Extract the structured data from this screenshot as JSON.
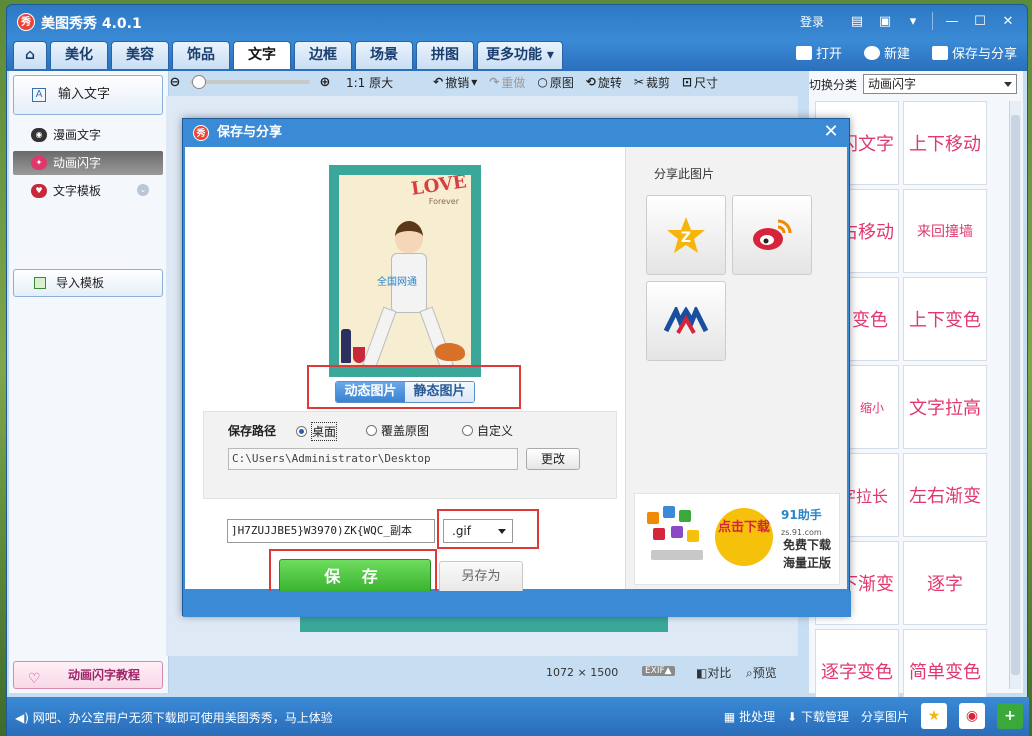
{
  "app": {
    "title": "美图秀秀 4.0.1",
    "logo_text": "秀",
    "login": "登录"
  },
  "tabs": [
    "美化",
    "美容",
    "饰品",
    "文字",
    "边框",
    "场景",
    "拼图",
    "更多功能"
  ],
  "active_tab": "文字",
  "quick_actions": {
    "open": "打开",
    "new": "新建",
    "save_share": "保存与分享"
  },
  "left_panel": {
    "input_text": "输入文字",
    "items": [
      "漫画文字",
      "动画闪字",
      "文字模板"
    ],
    "selected": "动画闪字",
    "import": "导入模板",
    "tutorial": "动画闪字教程"
  },
  "toolbar": {
    "zoom_original": "1:1 原大",
    "undo": "撤销",
    "redo": "重做",
    "original": "原图",
    "rotate": "旋转",
    "crop": "裁剪",
    "size": "尺寸",
    "zoom_level": 0.02
  },
  "status": {
    "dimensions": "1072 × 1500",
    "exif": "EXIF▲",
    "compare": "对比",
    "preview": "预览"
  },
  "right_panel": {
    "switch_label": "切换分类",
    "category": "动画闪字",
    "effects": [
      "闪文字",
      "上下移动",
      "右移动",
      "来回撞墙",
      "变色",
      "上下变色",
      "缩小",
      "文字拉高",
      "字拉长",
      "左右渐变",
      "下渐变",
      "逐字",
      "逐字变色",
      "简单变色"
    ]
  },
  "bottom": {
    "message": "网吧、办公室用户无须下载即可使用美图秀秀，马上体验",
    "batch": "批处理",
    "download_manager": "下载管理",
    "share_image": "分享图片"
  },
  "dialog": {
    "title": "保存与分享",
    "logo_text": "秀",
    "preview": {
      "love": "LOVE",
      "sub": "Forever",
      "watermark": "全国网通"
    },
    "mode": {
      "animated": "动态图片",
      "static": "静态图片",
      "selected": "动态图片"
    },
    "path_label": "保存路径",
    "options": [
      "桌面",
      "覆盖原图",
      "自定义"
    ],
    "option_selected": "桌面",
    "path": "C:\\Users\\Administrator\\Desktop",
    "change": "更改",
    "filename": "]H7ZUJJBE5}W3970)ZK{WQC_副本",
    "extension": ".gif",
    "save": "保 存",
    "save_as": "另存为",
    "share_title": "分享此图片",
    "ad": {
      "download": "点击下载",
      "brand": "91助手",
      "brand_sub": "zs.91.com",
      "line1": "免费下载",
      "line2": "海量正版"
    }
  }
}
